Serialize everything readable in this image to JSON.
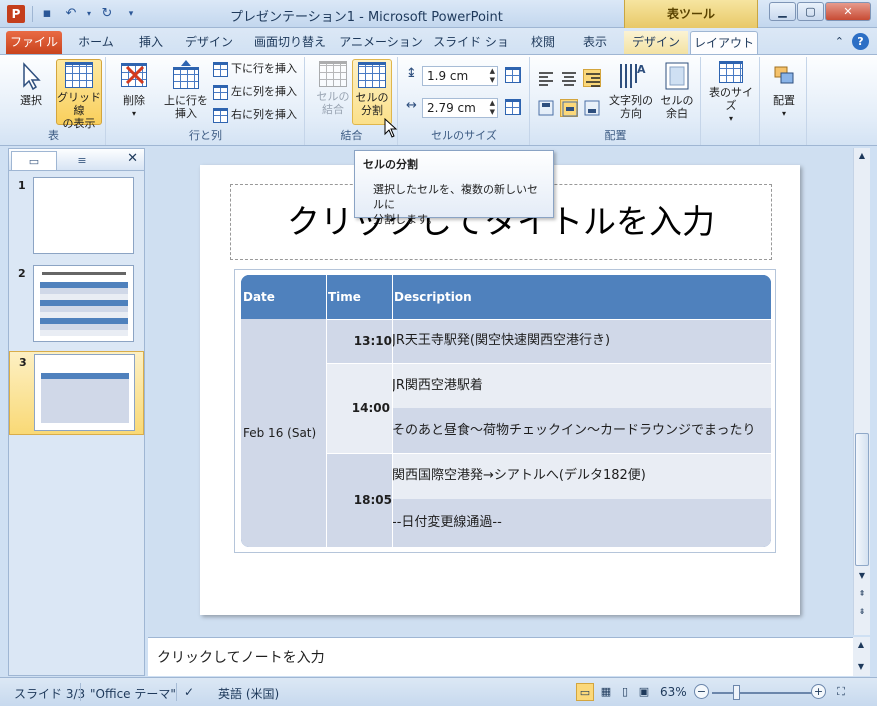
{
  "window": {
    "title": "プレゼンテーション1 - Microsoft PowerPoint",
    "app_icon": "P",
    "context_group": "表ツール"
  },
  "tabs": [
    "ファイル",
    "ホーム",
    "挿入",
    "デザイン",
    "画面切り替え",
    "アニメーション",
    "スライド ショー",
    "校閲",
    "表示",
    "デザイン",
    "レイアウト"
  ],
  "ribbon": {
    "groups": {
      "table": "表",
      "rows_cols": "行と列",
      "merge": "結合",
      "cell_size": "セルのサイズ",
      "align": "配置"
    },
    "select": "選択",
    "gridlines": [
      "グリッド線",
      "の表示"
    ],
    "delete": "削除",
    "insert_above": [
      "上に行を",
      "挿入"
    ],
    "insert_below": "下に行を挿入",
    "insert_left": "左に列を挿入",
    "insert_right": "右に列を挿入",
    "merge_cells": [
      "セルの",
      "結合"
    ],
    "split_cells": [
      "セルの",
      "分割"
    ],
    "height_value": "1.9 cm",
    "width_value": "2.79 cm",
    "text_direction": [
      "文字列の",
      "方向"
    ],
    "cell_margins": [
      "セルの",
      "余白"
    ],
    "table_size": "表のサイズ",
    "arrange": "配置"
  },
  "tooltip": {
    "title": "セルの分割",
    "body": [
      "選択したセルを、複数の新しいセルに",
      "分割します。"
    ]
  },
  "slides": [
    "1",
    "2",
    "3"
  ],
  "slide": {
    "title": "クリックしてタイトルを入力",
    "table": {
      "headers": [
        "Date",
        "Time",
        "Description"
      ],
      "date": "Feb 16 (Sat)",
      "times": [
        "13:10",
        "14:00",
        "18:05"
      ],
      "descriptions": [
        "JR天王寺駅発(関空快速関西空港行き)",
        "JR関西空港駅着",
        "そのあと昼食〜荷物チェックイン〜カードラウンジでまったり",
        "関西国際空港発→シアトルへ(デルタ182便)",
        "--日付変更線通過--"
      ]
    }
  },
  "notes_placeholder": "クリックしてノートを入力",
  "status": {
    "slide": "スライド 3/3",
    "theme": "\"Office テーマ\"",
    "language": "英語 (米国)",
    "zoom": "63%",
    "zoom_fraction": 0.24
  }
}
